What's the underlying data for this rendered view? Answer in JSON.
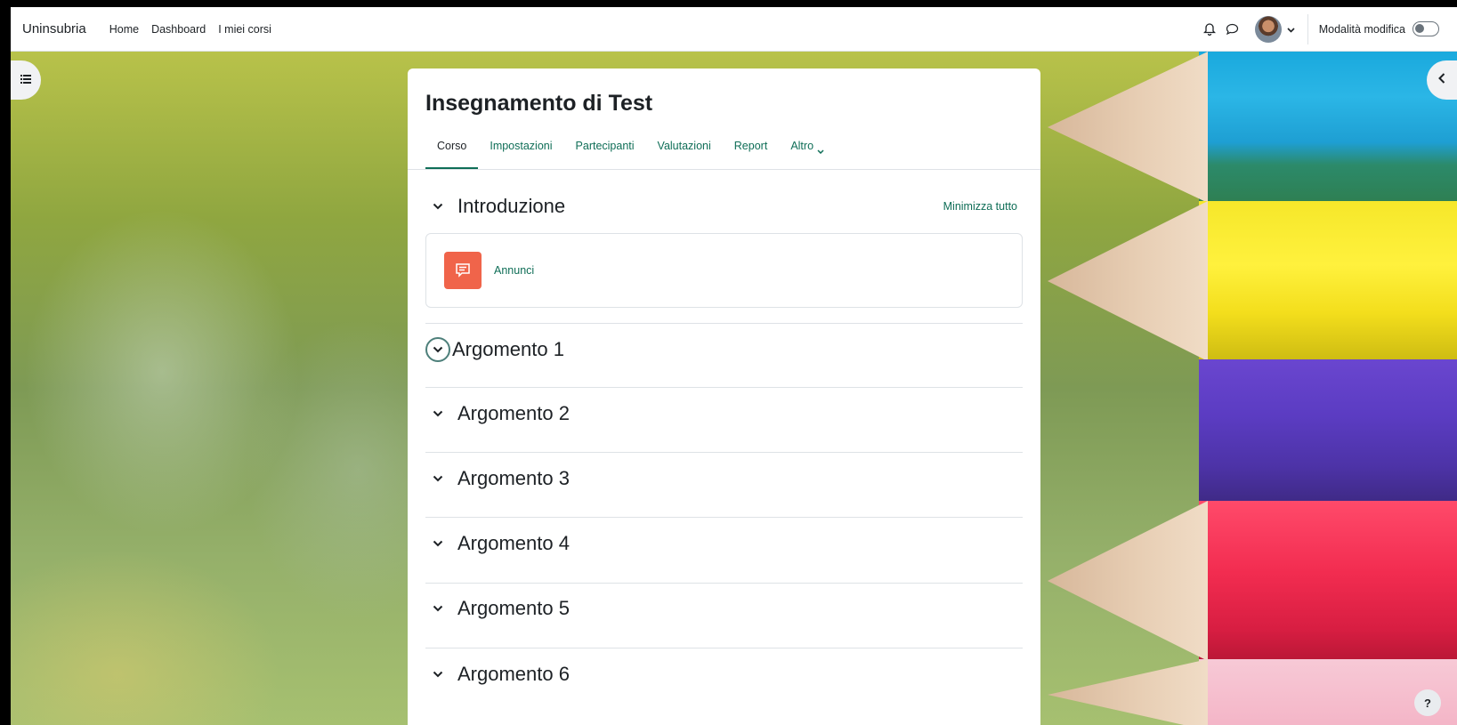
{
  "navbar": {
    "brand": "Uninsubria",
    "links": [
      "Home",
      "Dashboard",
      "I miei corsi"
    ],
    "edit_mode_label": "Modalità modifica",
    "icons": [
      "bell-icon",
      "chat-icon"
    ]
  },
  "course": {
    "title": "Insegnamento di Test",
    "tabs": [
      "Corso",
      "Impostazioni",
      "Partecipanti",
      "Valutazioni",
      "Report",
      "Altro"
    ],
    "active_tab": "Corso",
    "collapse_all": "Minimizza tutto"
  },
  "sections": [
    {
      "title": "Introduzione",
      "activities": [
        {
          "name": "Annunci",
          "icon": "forum-icon"
        }
      ]
    },
    {
      "title": "Argomento 1"
    },
    {
      "title": "Argomento 2"
    },
    {
      "title": "Argomento 3"
    },
    {
      "title": "Argomento 4"
    },
    {
      "title": "Argomento 5"
    },
    {
      "title": "Argomento 6"
    }
  ],
  "help_label": "?",
  "colors": {
    "accent": "#0f6e57",
    "activity_icon": "#f0644a",
    "text": "#1d2125"
  }
}
